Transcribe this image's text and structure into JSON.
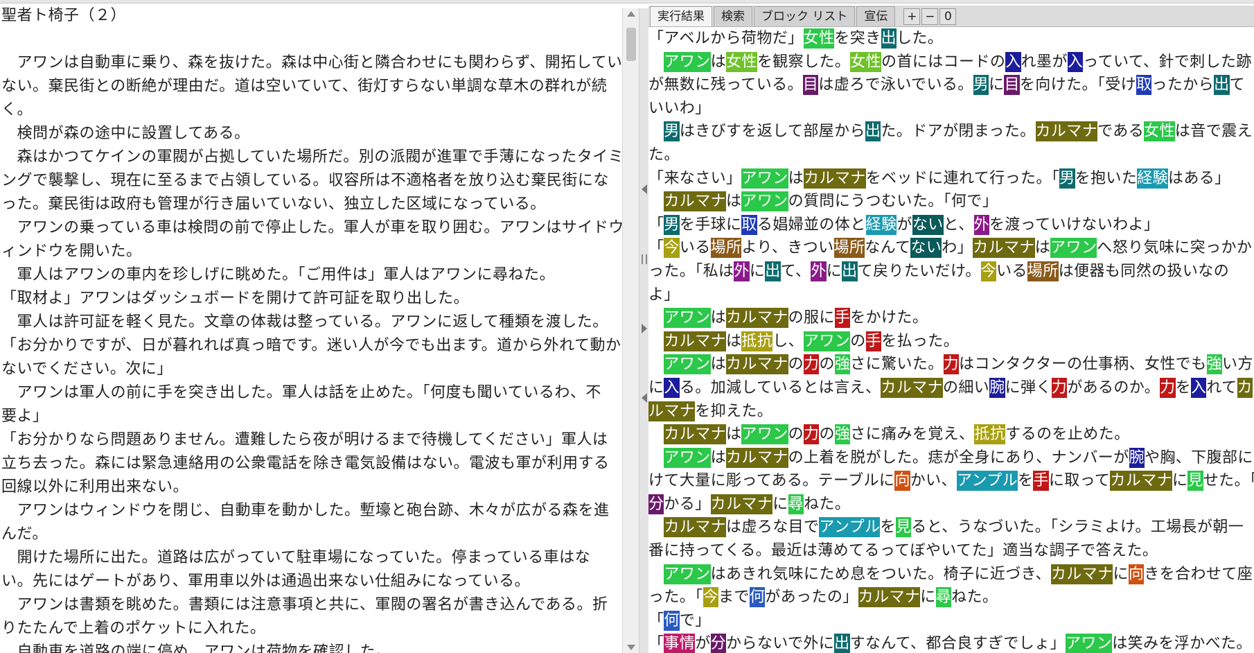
{
  "colors": {
    "lgreen": "#2cc84a",
    "green": "#6fc22a",
    "olive": "#6e6a10",
    "teal": "#0d6b6e",
    "blue": "#1f3ab8",
    "navy": "#1c1c9c",
    "purple": "#8a1a8a",
    "plum": "#6a1a6a",
    "mustard": "#a8a010",
    "brown": "#8a5a1a",
    "cyan": "#1a9ab0",
    "red": "#c01818",
    "orange": "#d05010",
    "darkteal": "#0a5a5a",
    "magenta": "#c01a6a",
    "royal": "#2a5ac0"
  },
  "tabs": [
    {
      "label": "実行結果"
    },
    {
      "label": "検索"
    },
    {
      "label": "ブロック リスト"
    },
    {
      "label": "宣伝"
    }
  ],
  "toolbar": {
    "plus": "+",
    "minus": "−",
    "zero": "0"
  },
  "left_lines": [
    "聖者ト椅子（２）",
    "",
    "　アワンは自動車に乗り、森を抜けた。森は中心街と隣合わせにも関わらず、開拓してい",
    "ない。棄民街との断絶が理由だ。道は空いていて、街灯すらない単調な草木の群れが続",
    "く。",
    "　検問が森の途中に設置してある。",
    "　森はかつてケインの軍閥が占拠していた場所だ。別の派閥が進軍で手薄になったタイミ",
    "ングで襲撃し、現在に至るまで占領している。収容所は不適格者を放り込む棄民街にな",
    "った。棄民街は政府も管理が行き届いていない、独立した区域になっている。",
    "　アワンの乗っている車は検問の前で停止した。軍人が車を取り囲む。アワンはサイドウ",
    "ィンドウを開いた。",
    "　軍人はアワンの車内を珍しげに眺めた。「ご用件は」軍人はアワンに尋ねた。",
    "「取材よ」アワンはダッシュボードを開けて許可証を取り出した。",
    "　軍人は許可証を軽く見た。文章の体裁は整っている。アワンに返して種類を渡した。",
    "「お分かりですが、日が暮れれば真っ暗です。迷い人が今でも出ます。道から外れて動か",
    "ないでください。次に」",
    "　アワンは軍人の前に手を突き出した。軍人は話を止めた。「何度も聞いているわ、不",
    "要よ」",
    "「お分かりなら問題ありません。遭難したら夜が明けるまで待機してください」軍人は",
    "立ち去った。森には緊急連絡用の公衆電話を除き電気設備はない。電波も軍が利用する",
    "回線以外に利用出来ない。",
    "　アワンはウィンドウを閉じ、自動車を動かした。塹壕と砲台跡、木々が広がる森を進",
    "んだ。",
    "　開けた場所に出た。道路は広がっていて駐車場になっていた。停まっている車はな",
    "い。先にはゲートがあり、軍用車以外は通過出来ない仕組みになっている。",
    "　アワンは書類を眺めた。書類には注意事項と共に、軍閥の署名が書き込んである。折",
    "りたたんで上着のポケットに入れた。",
    "　自動車を道路の端に停め、アワンは荷物を確認した。"
  ],
  "right_lines": [
    [
      [
        "「アベルから荷物だ」",
        ""
      ],
      [
        "女性",
        "lgreen"
      ],
      [
        "を突き",
        ""
      ],
      [
        "出",
        "teal"
      ],
      [
        "した。",
        ""
      ]
    ],
    [
      [
        "　",
        ""
      ],
      [
        "アワン",
        "lgreen"
      ],
      [
        "は",
        ""
      ],
      [
        "女性",
        "green"
      ],
      [
        "を観察した。",
        ""
      ],
      [
        "女性",
        "green"
      ],
      [
        "の首にはコードの",
        ""
      ],
      [
        "入",
        "navy"
      ],
      [
        "れ墨が",
        ""
      ],
      [
        "入",
        "navy"
      ],
      [
        "っていて、針で刺した跡",
        ""
      ]
    ],
    [
      [
        "が無数に残っている。",
        ""
      ],
      [
        "目",
        "plum"
      ],
      [
        "は虚ろで泳いでいる。",
        ""
      ],
      [
        "男",
        "teal"
      ],
      [
        "に",
        ""
      ],
      [
        "目",
        "plum"
      ],
      [
        "を向けた。「受け",
        ""
      ],
      [
        "取",
        "blue"
      ],
      [
        "ったから",
        ""
      ],
      [
        "出",
        "teal"
      ],
      [
        "て",
        ""
      ]
    ],
    [
      [
        "いいわ」",
        ""
      ]
    ],
    [
      [
        "　",
        ""
      ],
      [
        "男",
        "teal"
      ],
      [
        "はきびすを返して部屋から",
        ""
      ],
      [
        "出",
        "teal"
      ],
      [
        "た。ドアが閉まった。",
        ""
      ],
      [
        "カルマナ",
        "olive"
      ],
      [
        "である",
        ""
      ],
      [
        "女性",
        "lgreen"
      ],
      [
        "は音で震え",
        ""
      ]
    ],
    [
      [
        "た。",
        ""
      ]
    ],
    [
      [
        "「来なさい」",
        ""
      ],
      [
        "アワン",
        "lgreen"
      ],
      [
        "は",
        ""
      ],
      [
        "カルマナ",
        "olive"
      ],
      [
        "をベッドに連れて行った。「",
        ""
      ],
      [
        "男",
        "teal"
      ],
      [
        "を抱いた",
        ""
      ],
      [
        "経験",
        "cyan"
      ],
      [
        "はある」",
        ""
      ]
    ],
    [
      [
        "　",
        ""
      ],
      [
        "カルマナ",
        "olive"
      ],
      [
        "は",
        ""
      ],
      [
        "アワン",
        "lgreen"
      ],
      [
        "の質問にうつむいた。「何で」",
        ""
      ]
    ],
    [
      [
        "「",
        ""
      ],
      [
        "男",
        "teal"
      ],
      [
        "を手球に",
        ""
      ],
      [
        "取",
        "blue"
      ],
      [
        "る娼婦並の体と",
        ""
      ],
      [
        "経験",
        "cyan"
      ],
      [
        "が",
        ""
      ],
      [
        "ない",
        "darkteal"
      ],
      [
        "と、",
        ""
      ],
      [
        "外",
        "purple"
      ],
      [
        "を渡っていけないわよ」",
        ""
      ]
    ],
    [
      [
        "「",
        ""
      ],
      [
        "今",
        "mustard"
      ],
      [
        "いる",
        ""
      ],
      [
        "場所",
        "brown"
      ],
      [
        "より、きつい",
        ""
      ],
      [
        "場所",
        "brown"
      ],
      [
        "なんて",
        ""
      ],
      [
        "ない",
        "darkteal"
      ],
      [
        "わ」",
        ""
      ],
      [
        "カルマナ",
        "olive"
      ],
      [
        "は",
        ""
      ],
      [
        "アワン",
        "lgreen"
      ],
      [
        "へ怒り気味に突っかか",
        ""
      ]
    ],
    [
      [
        "った。「私は",
        ""
      ],
      [
        "外",
        "purple"
      ],
      [
        "に",
        ""
      ],
      [
        "出",
        "teal"
      ],
      [
        "て、",
        ""
      ],
      [
        "外",
        "purple"
      ],
      [
        "に",
        ""
      ],
      [
        "出",
        "teal"
      ],
      [
        "て戻りたいだけ。",
        ""
      ],
      [
        "今",
        "mustard"
      ],
      [
        "いる",
        ""
      ],
      [
        "場所",
        "brown"
      ],
      [
        "は便器も同然の扱いなの",
        ""
      ]
    ],
    [
      [
        "よ」",
        ""
      ]
    ],
    [
      [
        "　",
        ""
      ],
      [
        "アワン",
        "lgreen"
      ],
      [
        "は",
        ""
      ],
      [
        "カルマナ",
        "olive"
      ],
      [
        "の服に",
        ""
      ],
      [
        "手",
        "red"
      ],
      [
        "をかけた。",
        ""
      ]
    ],
    [
      [
        "　",
        ""
      ],
      [
        "カルマナ",
        "olive"
      ],
      [
        "は",
        ""
      ],
      [
        "抵抗",
        "mustard"
      ],
      [
        "し、",
        ""
      ],
      [
        "アワン",
        "lgreen"
      ],
      [
        "の",
        ""
      ],
      [
        "手",
        "red"
      ],
      [
        "を払った。",
        ""
      ]
    ],
    [
      [
        "　",
        ""
      ],
      [
        "アワン",
        "lgreen"
      ],
      [
        "は",
        ""
      ],
      [
        "カルマナ",
        "olive"
      ],
      [
        "の",
        ""
      ],
      [
        "力",
        "red"
      ],
      [
        "の",
        ""
      ],
      [
        "強",
        "lgreen"
      ],
      [
        "さに驚いた。",
        ""
      ],
      [
        "力",
        "red"
      ],
      [
        "はコンタクターの仕事柄、女性でも",
        ""
      ],
      [
        "強",
        "lgreen"
      ],
      [
        "い方",
        ""
      ]
    ],
    [
      [
        "に",
        ""
      ],
      [
        "入",
        "navy"
      ],
      [
        "る。加減しているとは言え、",
        ""
      ],
      [
        "カルマナ",
        "olive"
      ],
      [
        "の細い",
        ""
      ],
      [
        "腕",
        "navy"
      ],
      [
        "に弾く",
        ""
      ],
      [
        "力",
        "red"
      ],
      [
        "があるのか。",
        ""
      ],
      [
        "力",
        "red"
      ],
      [
        "を",
        ""
      ],
      [
        "入",
        "navy"
      ],
      [
        "れて",
        ""
      ],
      [
        "カ",
        "olive"
      ]
    ],
    [
      [
        "ルマナ",
        "olive"
      ],
      [
        "を抑えた。",
        ""
      ]
    ],
    [
      [
        "　",
        ""
      ],
      [
        "カルマナ",
        "olive"
      ],
      [
        "は",
        ""
      ],
      [
        "アワン",
        "lgreen"
      ],
      [
        "の",
        ""
      ],
      [
        "力",
        "red"
      ],
      [
        "の",
        ""
      ],
      [
        "強",
        "lgreen"
      ],
      [
        "さに痛みを覚え、",
        ""
      ],
      [
        "抵抗",
        "mustard"
      ],
      [
        "するのを止めた。",
        ""
      ]
    ],
    [
      [
        "　",
        ""
      ],
      [
        "アワン",
        "lgreen"
      ],
      [
        "は",
        ""
      ],
      [
        "カルマナ",
        "olive"
      ],
      [
        "の上着を脱がした。痣が全身にあり、ナンバーが",
        ""
      ],
      [
        "腕",
        "navy"
      ],
      [
        "や胸、下腹部にか",
        ""
      ]
    ],
    [
      [
        "けて大量に彫ってある。テーブルに",
        ""
      ],
      [
        "向",
        "orange"
      ],
      [
        "かい、",
        ""
      ],
      [
        "アンプル",
        "cyan"
      ],
      [
        "を",
        ""
      ],
      [
        "手",
        "red"
      ],
      [
        "に取って",
        ""
      ],
      [
        "カルマナ",
        "olive"
      ],
      [
        "に",
        ""
      ],
      [
        "見",
        "lgreen"
      ],
      [
        "せた。「",
        ""
      ]
    ],
    [
      [
        "分",
        "plum"
      ],
      [
        "かる」",
        ""
      ],
      [
        "カルマナ",
        "olive"
      ],
      [
        "に",
        ""
      ],
      [
        "尋",
        "lgreen"
      ],
      [
        "ねた。",
        ""
      ]
    ],
    [
      [
        "　",
        ""
      ],
      [
        "カルマナ",
        "olive"
      ],
      [
        "は虚ろな目で",
        ""
      ],
      [
        "アンプル",
        "cyan"
      ],
      [
        "を",
        ""
      ],
      [
        "見",
        "lgreen"
      ],
      [
        "ると、うなづいた。「シラミよけ。工場長が朝一",
        ""
      ]
    ],
    [
      [
        "番に持ってくる。最近は薄めてるってぼやいてた」適当な調子で答えた。",
        ""
      ]
    ],
    [
      [
        "　",
        ""
      ],
      [
        "アワン",
        "lgreen"
      ],
      [
        "はあきれ気味にため息をついた。椅子に近づき、",
        ""
      ],
      [
        "カルマナ",
        "olive"
      ],
      [
        "に",
        ""
      ],
      [
        "向",
        "orange"
      ],
      [
        "きを合わせて座",
        ""
      ]
    ],
    [
      [
        "った。「",
        ""
      ],
      [
        "今",
        "mustard"
      ],
      [
        "まで",
        ""
      ],
      [
        "何",
        "royal"
      ],
      [
        "があったの」",
        ""
      ],
      [
        "カルマナ",
        "olive"
      ],
      [
        "に",
        ""
      ],
      [
        "尋",
        "lgreen"
      ],
      [
        "ねた。",
        ""
      ]
    ],
    [
      [
        "「",
        ""
      ],
      [
        "何",
        "royal"
      ],
      [
        "で」",
        ""
      ]
    ],
    [
      [
        "「",
        ""
      ],
      [
        "事情",
        "magenta"
      ],
      [
        "が",
        ""
      ],
      [
        "分",
        "plum"
      ],
      [
        "からないで外に",
        ""
      ],
      [
        "出",
        "teal"
      ],
      [
        "すなんて、都合良すぎでしょ」",
        ""
      ],
      [
        "アワン",
        "lgreen"
      ],
      [
        "は笑みを浮かべた。",
        ""
      ]
    ]
  ]
}
